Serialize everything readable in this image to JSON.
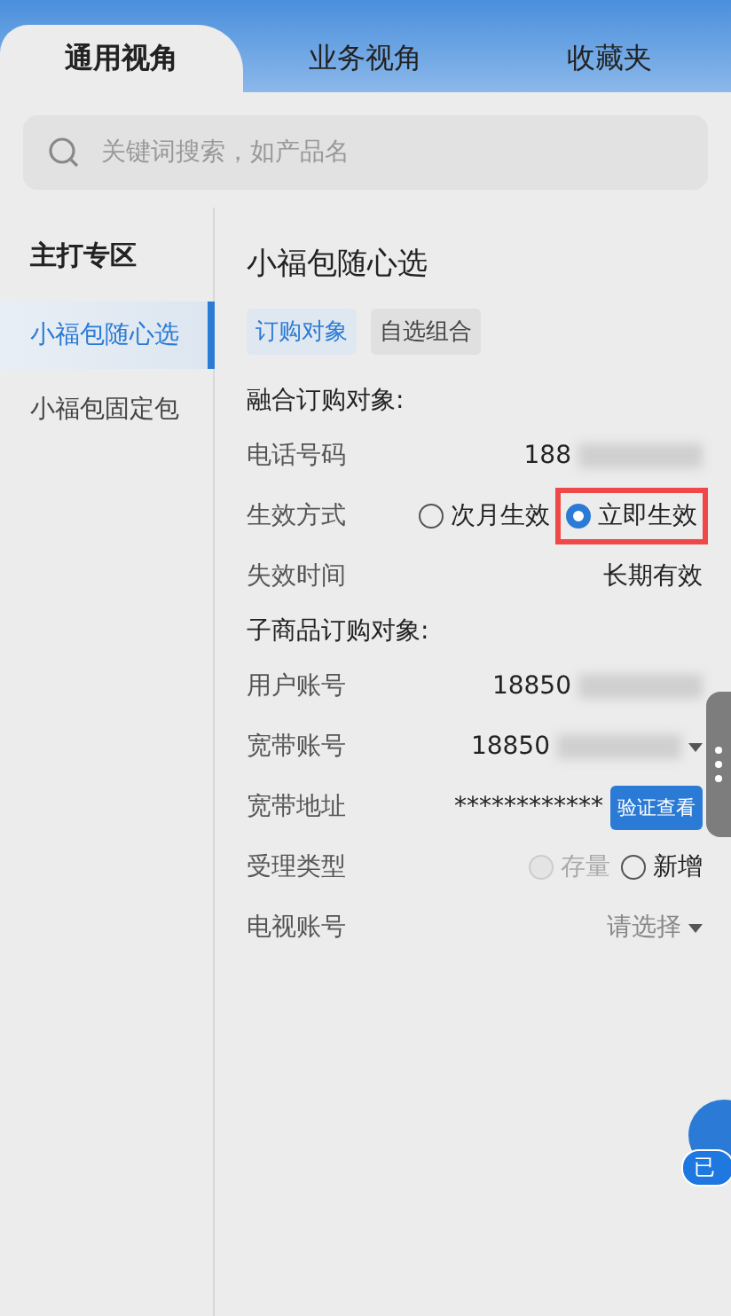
{
  "tabs": [
    {
      "label": "通用视角",
      "selected": true
    },
    {
      "label": "业务视角",
      "selected": false
    },
    {
      "label": "收藏夹",
      "selected": false
    }
  ],
  "search": {
    "placeholder": "关键词搜索，如产品名"
  },
  "sidebar": {
    "heading": "主打专区",
    "items": [
      {
        "label": "小福包随心选",
        "selected": true
      },
      {
        "label": "小福包固定包",
        "selected": false
      }
    ]
  },
  "panel": {
    "title": "小福包随心选",
    "subtabs": [
      {
        "label": "订购对象",
        "selected": true
      },
      {
        "label": "自选组合",
        "selected": false
      }
    ],
    "sections": [
      {
        "heading": "融合订购对象:",
        "rows": [
          {
            "kind": "text",
            "label": "电话号码",
            "value": "188",
            "masked": true
          },
          {
            "kind": "radio",
            "label": "生效方式",
            "options": [
              {
                "label": "次月生效",
                "selected": false,
                "disabled": false
              },
              {
                "label": "立即生效",
                "selected": true,
                "disabled": false,
                "highlighted": true
              }
            ]
          },
          {
            "kind": "text",
            "label": "失效时间",
            "value": "长期有效"
          }
        ]
      },
      {
        "heading": "子商品订购对象:",
        "rows": [
          {
            "kind": "text",
            "label": "用户账号",
            "value": "18850",
            "masked": true
          },
          {
            "kind": "select",
            "label": "宽带账号",
            "value": "18850",
            "masked": true
          },
          {
            "kind": "verify",
            "label": "宽带地址",
            "value": "************",
            "button": "验证查看"
          },
          {
            "kind": "radio",
            "label": "受理类型",
            "options": [
              {
                "label": "存量",
                "selected": false,
                "disabled": true
              },
              {
                "label": "新增",
                "selected": false,
                "disabled": false
              }
            ]
          },
          {
            "kind": "select",
            "label": "电视账号",
            "placeholder": "请选择"
          }
        ]
      }
    ]
  },
  "float_button": {
    "label": "已"
  }
}
